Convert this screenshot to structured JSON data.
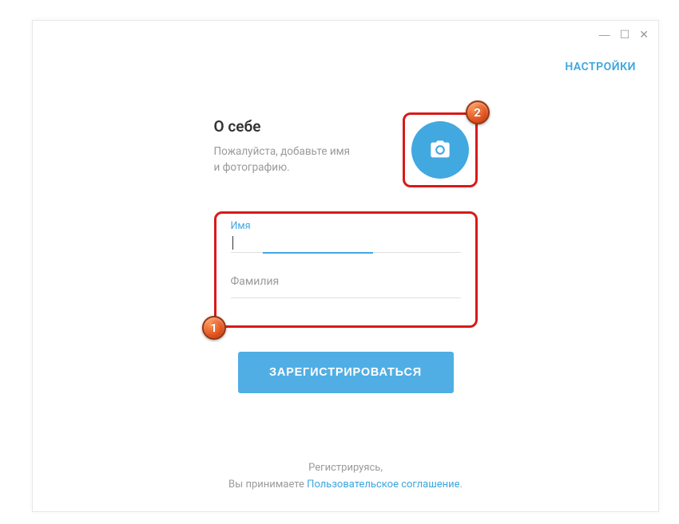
{
  "window": {
    "settings_link": "НАСТРОЙКИ"
  },
  "header": {
    "title": "О себе",
    "subtitle_line1": "Пожалуйста, добавьте имя",
    "subtitle_line2": "и фотографию."
  },
  "form": {
    "first_name_label": "Имя",
    "first_name_value": "",
    "last_name_label": "Фамилия",
    "last_name_value": "",
    "submit_label": "ЗАРЕГИСТРИРОВАТЬСЯ"
  },
  "footer": {
    "line1": "Регистрируясь,",
    "line2_prefix": "Вы принимаете ",
    "agreement_link": "Пользовательское соглашение",
    "line2_suffix": "."
  },
  "annotations": {
    "badge1": "1",
    "badge2": "2"
  }
}
